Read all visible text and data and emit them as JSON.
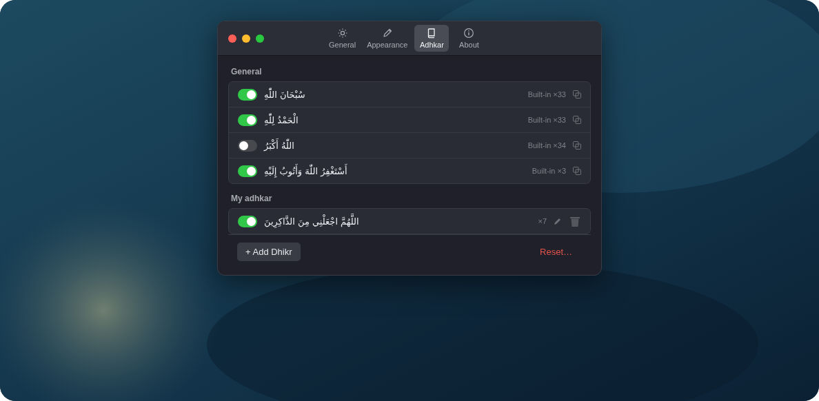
{
  "tabs": [
    {
      "label": "General",
      "selected": false
    },
    {
      "label": "Appearance",
      "selected": false
    },
    {
      "label": "Adhkar",
      "selected": true
    },
    {
      "label": "About",
      "selected": false
    }
  ],
  "sections": [
    {
      "title": "General",
      "items": [
        {
          "kind": "builtin",
          "on": true,
          "text": "سُبْحَانَ اللّٰهِ",
          "source": "Built-in",
          "count": "×33"
        },
        {
          "kind": "builtin",
          "on": true,
          "text": "الْحَمْدُ لِلّٰهِ",
          "source": "Built-in",
          "count": "×33"
        },
        {
          "kind": "builtin",
          "on": false,
          "text": "اللّٰهُ أَكْبَرُ",
          "source": "Built-in",
          "count": "×34"
        },
        {
          "kind": "builtin",
          "on": true,
          "text": "أَسْتَغْفِرُ اللّٰهَ وَأَتُوبُ إِلَيْهِ",
          "source": "Built-in",
          "count": "×3"
        }
      ]
    },
    {
      "title": "My adhkar",
      "items": [
        {
          "kind": "custom",
          "on": true,
          "text": "اللَّهُمَّ اجْعَلْنِي مِنَ الذَّاكِرِينَ",
          "count": "×7"
        }
      ]
    }
  ],
  "footer": {
    "add_label": "+ Add Dhikr",
    "reset_label": "Reset…"
  }
}
